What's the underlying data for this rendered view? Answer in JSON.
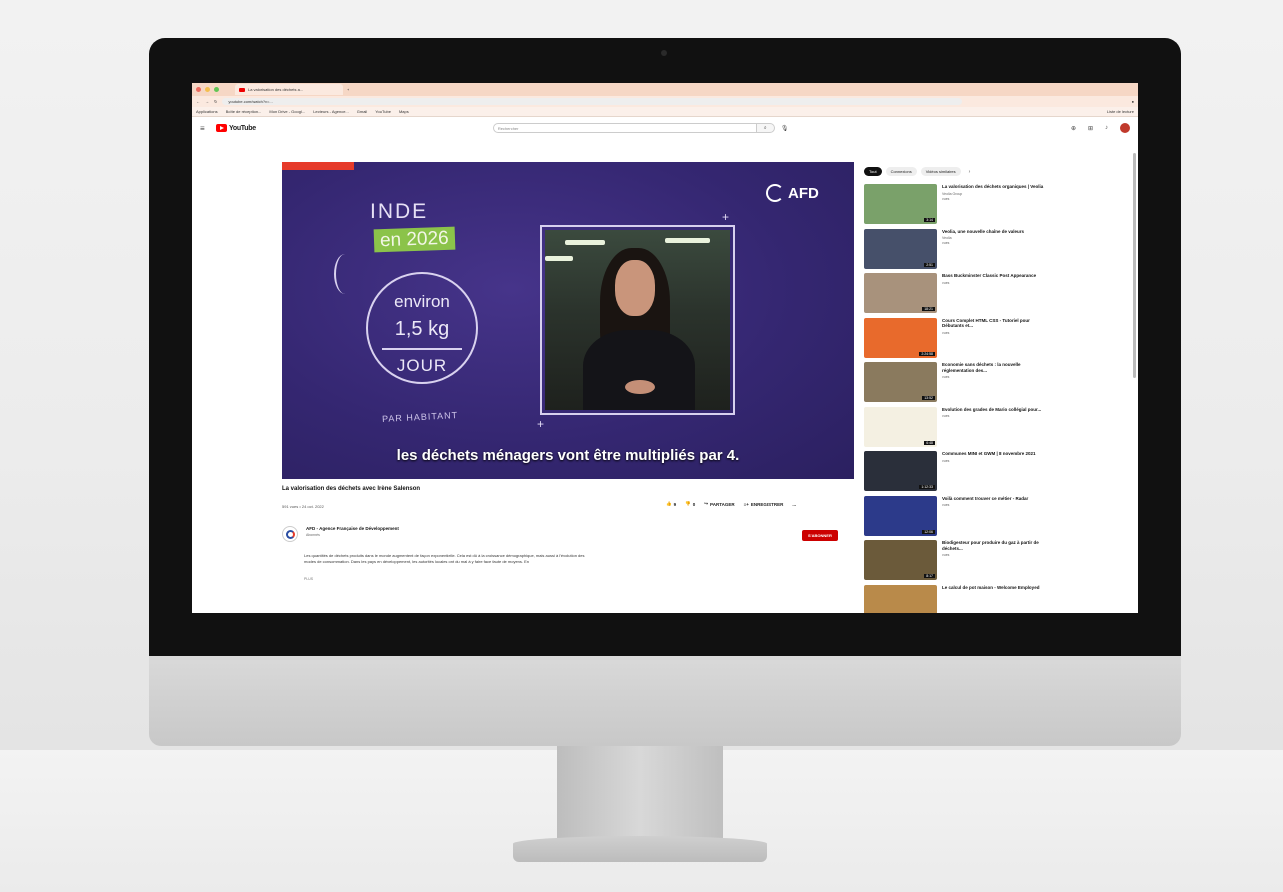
{
  "browser": {
    "tab_title": "La valorisation des déchets a...",
    "url": "youtube.com/watch?v=...",
    "bookmarks": [
      "Applications",
      "Boîte de réception...",
      "Mon Drive - Googl...",
      "Lecteurs - Agence...",
      "Gmail",
      "YouTube",
      "Maps"
    ],
    "reading_list": "Liste de lecture"
  },
  "youtube": {
    "logo_text": "YouTube",
    "search_placeholder": "Rechercher"
  },
  "video": {
    "overlay_inde": "INDE",
    "overlay_year": "en 2026",
    "overlay_environ": "environ",
    "overlay_kg": "1,5 kg",
    "overlay_jour": "JOUR",
    "overlay_par_habitant": "PAR HABITANT",
    "afd_logo": "AFD",
    "subtitle": "les déchets ménagers vont être multipliés par 4.",
    "title": "La valorisation des déchets avec Irène Salenson",
    "meta": "591 vues • 24 oct. 2022",
    "likes": "9",
    "dislike_label": "0",
    "share_label": "PARTAGER",
    "save_label": "ENREGISTRER",
    "more_label": "..."
  },
  "channel": {
    "name": "AFD - Agence Française de Développement",
    "subscribers": "Abonnés",
    "subscribe_label": "S'ABONNER",
    "description": "Les quantités de déchets produits dans le monde augmentent de façon exponentielle. Cela est dû à la croissance démographique, mais aussi à l'évolution des modes de consommation. Dans les pays en développement, les autorités locales ont du mal à y faire face faute de moyens. En",
    "more": "PLUS"
  },
  "sidebar": {
    "chips": [
      "Tout",
      "Connexions",
      "Vidéos similaires"
    ],
    "recommendations": [
      {
        "title": "La valorisation des déchets organiques | Veolia",
        "channel": "Veolia Group",
        "views": "vues",
        "duration": "3:14",
        "color": "#7aa16a"
      },
      {
        "title": "Veolia, une nouvelle chaîne de valeurs",
        "channel": "Veolia",
        "views": "vues",
        "duration": "2:51",
        "color": "#46506a"
      },
      {
        "title": "Bass Buckminster Classic Post Appearance",
        "channel": "",
        "views": "vues",
        "duration": "18:21",
        "color": "#a8927c"
      },
      {
        "title": "Cours Complet HTML CSS - Tutoriel pour Débutants et...",
        "channel": "",
        "views": "vues",
        "duration": "2:24:58",
        "color": "#e86a2c"
      },
      {
        "title": "Economie sans déchets : la nouvelle réglementation des...",
        "channel": "",
        "views": "vues",
        "duration": "13:52",
        "color": "#8a7a5e"
      },
      {
        "title": "Evolution des grades de Mario collégial pour...",
        "channel": "",
        "views": "vues",
        "duration": "6:48",
        "color": "#f4f0e2"
      },
      {
        "title": "Communes MINI et GWM | 8 novembre 2021",
        "channel": "",
        "views": "vues",
        "duration": "1:12:33",
        "color": "#2a2f3a"
      },
      {
        "title": "Voilà comment trouver ce métier - Radar",
        "channel": "",
        "views": "vues",
        "duration": "12:06",
        "color": "#2c3a8a"
      },
      {
        "title": "Biodigesteur pour produire du gaz à partir de déchets...",
        "channel": "",
        "views": "vues",
        "duration": "8:17",
        "color": "#6b5a3a"
      },
      {
        "title": "Le calcul de pot maison - Welcome Employed",
        "channel": "",
        "views": "",
        "duration": "",
        "color": "#b98a4a"
      }
    ]
  }
}
